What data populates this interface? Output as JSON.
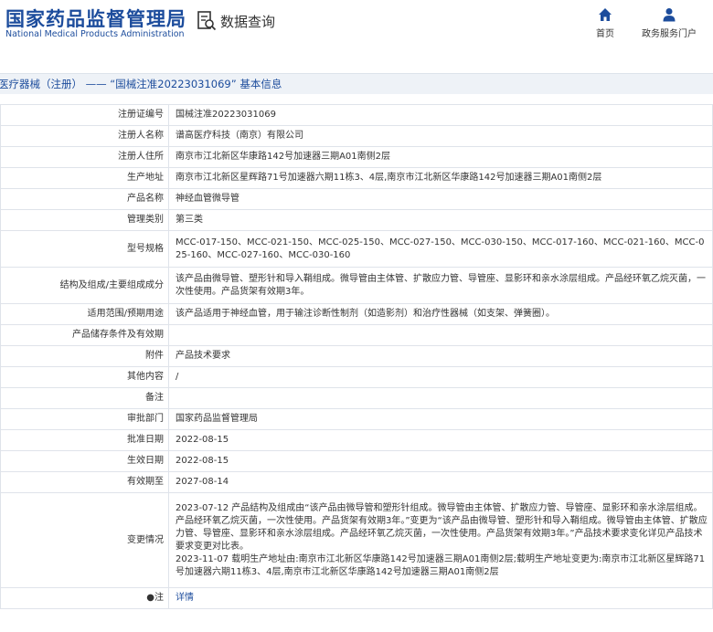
{
  "header": {
    "logo_cn": "国家药品监督管理局",
    "logo_en": "National Medical Products Administration",
    "query_label": "数据查询",
    "nav_home": "首页",
    "nav_gov": "政务服务门户",
    "brand_color": "#1c4c9c"
  },
  "titlebar": "医疗器械（注册） —— “国械注准20223031069” 基本信息",
  "rows": [
    {
      "label": "注册证编号",
      "value": "国械注准20223031069"
    },
    {
      "label": "注册人名称",
      "value": "谱高医疗科技（南京）有限公司"
    },
    {
      "label": "注册人住所",
      "value": "南京市江北新区华康路142号加速器三期A01南侧2层"
    },
    {
      "label": "生产地址",
      "value": "南京市江北新区星辉路71号加速器六期11栋3、4层,南京市江北新区华康路142号加速器三期A01南侧2层"
    },
    {
      "label": "产品名称",
      "value": "神经血管微导管"
    },
    {
      "label": "管理类别",
      "value": "第三类"
    },
    {
      "label": "型号规格",
      "value": "MCC-017-150、MCC-021-150、MCC-025-150、MCC-027-150、MCC-030-150、MCC-017-160、MCC-021-160、MCC-025-160、MCC-027-160、MCC-030-160"
    },
    {
      "label": "结构及组成/主要组成成分",
      "value": "该产品由微导管、塑形针和导入鞘组成。微导管由主体管、扩散应力管、导管座、显影环和亲水涂层组成。产品经环氧乙烷灭菌，一次性使用。产品货架有效期3年。"
    },
    {
      "label": "适用范围/预期用途",
      "value": "该产品适用于神经血管，用于输注诊断性制剂（如造影剂）和治疗性器械（如支架、弹簧圈）。"
    },
    {
      "label": "产品储存条件及有效期",
      "value": ""
    },
    {
      "label": "附件",
      "value": "产品技术要求"
    },
    {
      "label": "其他内容",
      "value": "/"
    },
    {
      "label": "备注",
      "value": ""
    },
    {
      "label": "审批部门",
      "value": "国家药品监督管理局"
    },
    {
      "label": "批准日期",
      "value": "2022-08-15"
    },
    {
      "label": "生效日期",
      "value": "2022-08-15"
    },
    {
      "label": "有效期至",
      "value": "2027-08-14"
    },
    {
      "label": "变更情况",
      "value": "2023-07-12 产品结构及组成由“该产品由微导管和塑形针组成。微导管由主体管、扩散应力管、导管座、显影环和亲水涂层组成。产品经环氧乙烷灭菌，一次性使用。产品货架有效期3年。”变更为“该产品由微导管、塑形针和导入鞘组成。微导管由主体管、扩散应力管、导管座、显影环和亲水涂层组成。产品经环氧乙烷灭菌，一次性使用。产品货架有效期3年。”产品技术要求变化详见产品技术要求变更对比表。",
      "value2": "2023-11-07 载明生产地址由:南京市江北新区华康路142号加速器三期A01南侧2层;载明生产地址变更为:南京市江北新区星辉路71号加速器六期11栋3、4层,南京市江北新区华康路142号加速器三期A01南侧2层"
    },
    {
      "label": "●注",
      "value": "详情"
    }
  ]
}
